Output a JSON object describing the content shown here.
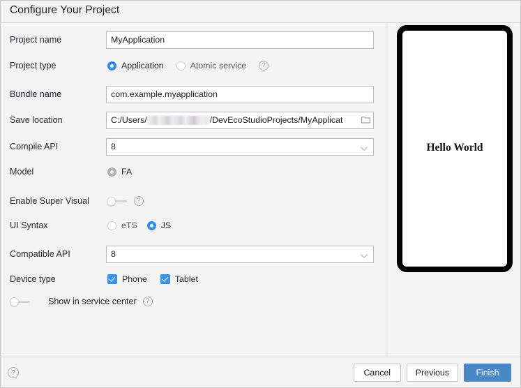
{
  "dialog": {
    "title": "Configure Your Project"
  },
  "form": {
    "rows": [
      {
        "label": "Project name",
        "type": "text",
        "value": "MyApplication"
      },
      {
        "label": "Project type",
        "type": "radio",
        "options": [
          "Application",
          "Atomic service"
        ],
        "selected": "Application",
        "help": "?"
      },
      {
        "label": "Bundle name",
        "type": "text",
        "value": "com.example.myapplication"
      },
      {
        "label": "Save location",
        "type": "path",
        "value_prefix": "C:/Users/",
        "value_suffix": "/DevEcoStudioProjects/MyApplicat",
        "icon": "folder-icon"
      },
      {
        "label": "Compile API",
        "type": "select",
        "value": "8",
        "icon": "chevron-down-icon"
      },
      {
        "label": "Model",
        "type": "radio",
        "options": [
          "FA"
        ],
        "selected": "FA"
      },
      {
        "label": "Enable Super Visual",
        "type": "toggle",
        "value": "off",
        "help": "?"
      },
      {
        "label": "UI Syntax",
        "type": "radio",
        "options": [
          "eTS",
          "JS"
        ],
        "selected": "JS"
      },
      {
        "label": "Compatible API",
        "type": "select",
        "value": "8",
        "icon": "chevron-down-icon"
      },
      {
        "label": "Device type",
        "type": "checkbox",
        "options": [
          "Phone",
          "Tablet"
        ],
        "checked": [
          "Phone",
          "Tablet"
        ]
      }
    ],
    "service_center": {
      "label": "Show in service center",
      "value": "off",
      "help": "?"
    }
  },
  "preview": {
    "text": "Hello World"
  },
  "footer": {
    "help": "?",
    "buttons": [
      {
        "label": "Cancel",
        "primary": false
      },
      {
        "label": "Previous",
        "primary": false
      },
      {
        "label": "Finish",
        "primary": true
      }
    ]
  },
  "colors": {
    "accent": "#2f8cf0",
    "checkbox": "#3a92f0",
    "primary_button": "#4a87c7",
    "background": "#f4f4f4",
    "field_background": "#ffffff",
    "border": "#b8b8b8"
  }
}
